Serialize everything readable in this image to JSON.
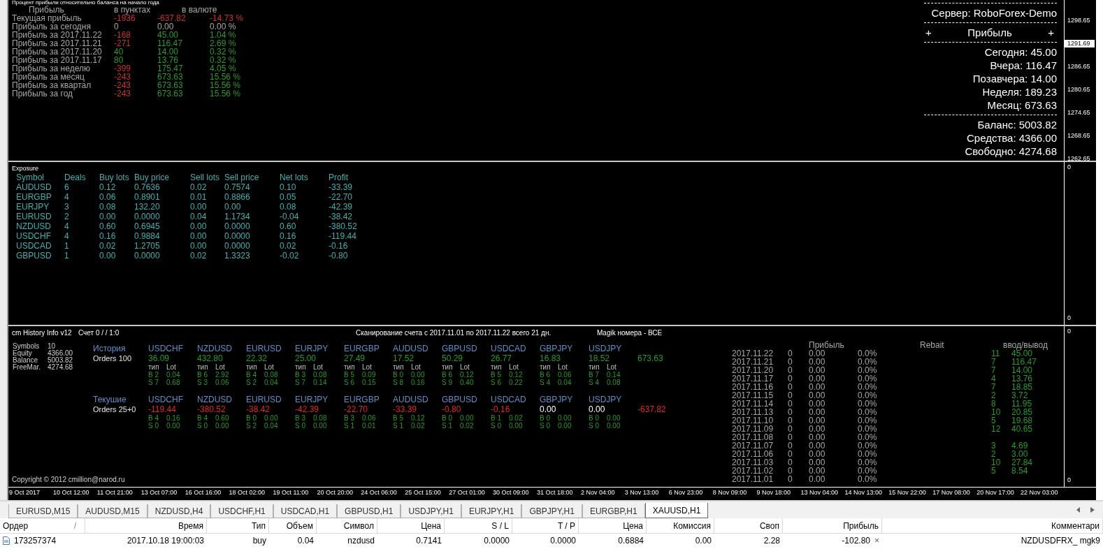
{
  "profit_panel": {
    "caption": "Процент прибыли относительно баланса на начало года",
    "headers": [
      "Прибыль",
      "в пунктах",
      "в валюте"
    ],
    "rows": [
      {
        "label": "Текущая прибыль",
        "cells": [
          {
            "text": "-1936",
            "color": "#c83232"
          },
          {
            "text": "-637.82",
            "color": "#c83232"
          },
          {
            "text": "-14.73 %",
            "color": "#c83232"
          }
        ]
      },
      {
        "label": "Прибыль за сегодня",
        "cells": [
          {
            "text": "0",
            "color": "#a8a8a8"
          },
          {
            "text": "0.00",
            "color": "#a8a8a8"
          },
          {
            "text": "0.00 %",
            "color": "#a8a8a8"
          }
        ]
      },
      {
        "label": "Прибыль за 2017.11.22",
        "cells": [
          {
            "text": "-168",
            "color": "#c83232"
          },
          {
            "text": "45.00",
            "color": "#2c9a2c"
          },
          {
            "text": "1.04 %",
            "color": "#2c9a2c"
          }
        ]
      },
      {
        "label": "Прибыль за 2017.11.21",
        "cells": [
          {
            "text": "-271",
            "color": "#c83232"
          },
          {
            "text": "116.47",
            "color": "#2c9a2c"
          },
          {
            "text": "2.69 %",
            "color": "#2c9a2c"
          }
        ]
      },
      {
        "label": "Прибыль за 2017.11.20",
        "cells": [
          {
            "text": "40",
            "color": "#2c9a2c"
          },
          {
            "text": "14.00",
            "color": "#2c9a2c"
          },
          {
            "text": "0.32 %",
            "color": "#2c9a2c"
          }
        ]
      },
      {
        "label": "Прибыль за 2017.11.17",
        "cells": [
          {
            "text": "80",
            "color": "#2c9a2c"
          },
          {
            "text": "13.76",
            "color": "#2c9a2c"
          },
          {
            "text": "0.32 %",
            "color": "#2c9a2c"
          }
        ]
      },
      {
        "label": "Прибыль за неделю",
        "cells": [
          {
            "text": "-399",
            "color": "#c83232"
          },
          {
            "text": "175.47",
            "color": "#2c9a2c"
          },
          {
            "text": "4.05 %",
            "color": "#2c9a2c"
          }
        ]
      },
      {
        "label": "Прибыль за месяц",
        "cells": [
          {
            "text": "-243",
            "color": "#c83232"
          },
          {
            "text": "673.63",
            "color": "#2c9a2c"
          },
          {
            "text": "15.56 %",
            "color": "#2c9a2c"
          }
        ]
      },
      {
        "label": "Прибыль за квартал",
        "cells": [
          {
            "text": "-243",
            "color": "#c83232"
          },
          {
            "text": "673.63",
            "color": "#2c9a2c"
          },
          {
            "text": "15.56 %",
            "color": "#2c9a2c"
          }
        ]
      },
      {
        "label": "Прибыль за год",
        "cells": [
          {
            "text": "-243",
            "color": "#c83232"
          },
          {
            "text": "673.63",
            "color": "#2c9a2c"
          },
          {
            "text": "15.56 %",
            "color": "#2c9a2c"
          }
        ]
      }
    ]
  },
  "info_panel": {
    "server": "Сервер: RoboForex-Demo",
    "profit_heading": [
      "+",
      "Прибыль",
      "+"
    ],
    "stats": [
      "Сегодня: 45.00",
      "Вчера: 116.47",
      "Позавчера: 14.00",
      "Неделя: 189.23",
      "Месяц: 673.63"
    ],
    "balance": [
      "Баланс: 5003.82",
      "Средства: 4366.00",
      "Свободно: 4274.68"
    ]
  },
  "price_scale": [
    {
      "text": "1298.65",
      "kind": "tick"
    },
    {
      "text": "1291.69",
      "kind": "current"
    },
    {
      "text": "1286.65",
      "kind": "tick"
    },
    {
      "text": "1280.65",
      "kind": "tick"
    },
    {
      "text": "1274.65",
      "kind": "tick"
    },
    {
      "text": "1268.65",
      "kind": "tick"
    },
    {
      "text": "1262.65",
      "kind": "tick"
    }
  ],
  "exposure": {
    "title": "Exposure",
    "columns": [
      "Symbol",
      "Deals",
      "Buy lots",
      "Buy price",
      "Sell lots",
      "Sell price",
      "Net lots",
      "Profit"
    ],
    "rows": [
      [
        "AUDUSD",
        "6",
        "0.12",
        "0.7636",
        "0.02",
        "0.7574",
        "0.10",
        "-33.39"
      ],
      [
        "EURGBP",
        "4",
        "0.06",
        "0.8901",
        "0.01",
        "0.8866",
        "0.05",
        "-22.70"
      ],
      [
        "EURJPY",
        "3",
        "0.08",
        "132.20",
        "0.00",
        "0.00",
        "0.08",
        "-42.39"
      ],
      [
        "EURUSD",
        "2",
        "0.00",
        "0.0000",
        "0.04",
        "1.1734",
        "-0.04",
        "-38.42"
      ],
      [
        "NZDUSD",
        "4",
        "0.60",
        "0.6945",
        "0.00",
        "0.0000",
        "0.60",
        "-380.52"
      ],
      [
        "USDCHF",
        "4",
        "0.16",
        "0.9884",
        "0.00",
        "0.0000",
        "0.16",
        "-119.44"
      ],
      [
        "USDCAD",
        "1",
        "0.02",
        "1.2705",
        "0.00",
        "0.0000",
        "0.02",
        "-0.16"
      ],
      [
        "GBPUSD",
        "1",
        "0.00",
        "0.0000",
        "0.02",
        "1.3323",
        "-0.02",
        "-0.80"
      ]
    ],
    "scale": [
      "0",
      "0"
    ]
  },
  "history_panel": {
    "title": "cm History Info v12",
    "account": "Счет 0 / / 1:0",
    "scan": "Сканирование счета с 2017.11.01 по 2017.11.22 всего 21 дн.",
    "magic": "Magik номера - ВСЕ",
    "account_info": [
      {
        "label": "Symbols",
        "value": "10"
      },
      {
        "label": "Equity",
        "value": "4366.00"
      },
      {
        "label": "Balance",
        "value": "5003.82"
      },
      {
        "label": "FreeMar.",
        "value": "4274.68"
      }
    ],
    "groups": [
      {
        "label": "История",
        "orders": "Orders 100",
        "total": {
          "text": "673.63",
          "color": "#2c9a2c"
        },
        "symbols": [
          {
            "name": "USDCHF",
            "value": "36.09",
            "color": "#2c9a2c",
            "type_label": "тип",
            "lot_label": "Lot",
            "buy": [
              "B 2",
              "0.04"
            ],
            "sell": [
              "S 7",
              "0.68"
            ]
          },
          {
            "name": "NZDUSD",
            "value": "432.80",
            "color": "#2c9a2c",
            "type_label": "тип",
            "lot_label": "Lot",
            "buy": [
              "B 6",
              "2.92"
            ],
            "sell": [
              "S 3",
              "0.06"
            ]
          },
          {
            "name": "EURUSD",
            "value": "22.32",
            "color": "#2c9a2c",
            "type_label": "тип",
            "lot_label": "Lot",
            "buy": [
              "B 4",
              "0.08"
            ],
            "sell": [
              "S 2",
              "0.04"
            ]
          },
          {
            "name": "EURJPY",
            "value": "25.00",
            "color": "#2c9a2c",
            "type_label": "тип",
            "lot_label": "Lot",
            "buy": [
              "B 3",
              "0.08"
            ],
            "sell": [
              "S 7",
              "0.14"
            ]
          },
          {
            "name": "EURGBP",
            "value": "27.49",
            "color": "#2c9a2c",
            "type_label": "тип",
            "lot_label": "Lot",
            "buy": [
              "B 5",
              "0.09"
            ],
            "sell": [
              "S 6",
              "0.15"
            ]
          },
          {
            "name": "AUDUSD",
            "value": "17.52",
            "color": "#2c9a2c",
            "type_label": "тип",
            "lot_label": "Lot",
            "buy": [
              "B 0",
              "0.00"
            ],
            "sell": [
              "S 8",
              "0.16"
            ]
          },
          {
            "name": "GBPUSD",
            "value": "50.29",
            "color": "#2c9a2c",
            "type_label": "тип",
            "lot_label": "Lot",
            "buy": [
              "B 6",
              "0.12"
            ],
            "sell": [
              "S 9",
              "0.40"
            ]
          },
          {
            "name": "USDCAD",
            "value": "26.77",
            "color": "#2c9a2c",
            "type_label": "тип",
            "lot_label": "Lot",
            "buy": [
              "B 5",
              "0.12"
            ],
            "sell": [
              "S 6",
              "0.22"
            ]
          },
          {
            "name": "GBPJPY",
            "value": "16.83",
            "color": "#2c9a2c",
            "type_label": "тип",
            "lot_label": "Lot",
            "buy": [
              "B 6",
              "0.06"
            ],
            "sell": [
              "S 4",
              "0.04"
            ]
          },
          {
            "name": "USDJPY",
            "value": "18.52",
            "color": "#2c9a2c",
            "type_label": "тип",
            "lot_label": "Lot",
            "buy": [
              "B 7",
              "0.14"
            ],
            "sell": [
              "S 4",
              "0.08"
            ]
          }
        ]
      },
      {
        "label": "Текушие",
        "orders": "Orders 25+0",
        "total": {
          "text": "-637.82",
          "color": "#e02828"
        },
        "symbols": [
          {
            "name": "USDCHF",
            "value": "-119.44",
            "color": "#e02828",
            "buy": [
              "B 4",
              "0.16"
            ],
            "sell": [
              "S 0",
              "0.00"
            ]
          },
          {
            "name": "NZDUSD",
            "value": "-380.52",
            "color": "#e02828",
            "buy": [
              "B 4",
              "0.60"
            ],
            "sell": [
              "S 0",
              "0.00"
            ]
          },
          {
            "name": "EURUSD",
            "value": "-38.42",
            "color": "#e02828",
            "buy": [
              "B 0",
              "0.00"
            ],
            "sell": [
              "S 2",
              "0.04"
            ]
          },
          {
            "name": "EURJPY",
            "value": "-42.39",
            "color": "#e02828",
            "buy": [
              "B 3",
              "0.08"
            ],
            "sell": [
              "S 0",
              "0.00"
            ]
          },
          {
            "name": "EURGBP",
            "value": "-22.70",
            "color": "#e02828",
            "buy": [
              "B 3",
              "0.06"
            ],
            "sell": [
              "S 1",
              "0.01"
            ]
          },
          {
            "name": "AUDUSD",
            "value": "-33.39",
            "color": "#e02828",
            "buy": [
              "B 5",
              "0.12"
            ],
            "sell": [
              "S 1",
              "0.02"
            ]
          },
          {
            "name": "GBPUSD",
            "value": "-0.80",
            "color": "#e02828",
            "buy": [
              "B 0",
              "0.00"
            ],
            "sell": [
              "S 1",
              "0.02"
            ]
          },
          {
            "name": "USDCAD",
            "value": "-0.16",
            "color": "#e02828",
            "buy": [
              "B 1",
              "0.02"
            ],
            "sell": [
              "S 0",
              "0.00"
            ]
          },
          {
            "name": "GBPJPY",
            "value": "0.00",
            "color": "#ffffff",
            "buy": [
              "B 0",
              "0.00"
            ],
            "sell": [
              "S 0",
              "0.00"
            ]
          },
          {
            "name": "USDJPY",
            "value": "0.00",
            "color": "#ffffff",
            "buy": [
              "B 0",
              "0.00"
            ],
            "sell": [
              "S 0",
              "0.00"
            ]
          }
        ]
      }
    ],
    "daily_headers": [
      "Прибыль",
      "Rebait",
      "ввод/вывод"
    ],
    "daily": [
      [
        "2017.11.22",
        "0",
        "0.00",
        "0.0%",
        "11",
        "45.00"
      ],
      [
        "2017.11.21",
        "0",
        "0.00",
        "0.0%",
        "7",
        "116.47"
      ],
      [
        "2017.11.20",
        "0",
        "0.00",
        "0.0%",
        "7",
        "14.00"
      ],
      [
        "2017.11.17",
        "0",
        "0.00",
        "0.0%",
        "4",
        "13.76"
      ],
      [
        "2017.11.16",
        "0",
        "0.00",
        "0.0%",
        "7",
        "18.85"
      ],
      [
        "2017.11.15",
        "0",
        "0.00",
        "0.0%",
        "2",
        "3.72"
      ],
      [
        "2017.11.14",
        "0",
        "0.00",
        "0.0%",
        "8",
        "11.95"
      ],
      [
        "2017.11.13",
        "0",
        "0.00",
        "0.0%",
        "10",
        "20.85"
      ],
      [
        "2017.11.10",
        "0",
        "0.00",
        "0.0%",
        "5",
        "19.68"
      ],
      [
        "2017.11.09",
        "0",
        "0.00",
        "0.0%",
        "12",
        "40.65"
      ],
      [
        "2017.11.08",
        "0",
        "0.00",
        "0.0%"
      ],
      [
        "2017.11.07",
        "0",
        "0.00",
        "0.0%",
        "3",
        "4.69"
      ],
      [
        "2017.11.06",
        "0",
        "0.00",
        "0.0%",
        "2",
        "3.00"
      ],
      [
        "2017.11.03",
        "0",
        "0.00",
        "0.0%",
        "10",
        "27.84"
      ],
      [
        "2017.11.02",
        "0",
        "0.00",
        "0.0%",
        "5",
        "8.54"
      ],
      [
        "2017.11.01",
        "0",
        "0.00",
        "0.0%"
      ]
    ],
    "copyright": "Copyright © 2012 cmillion@narod.ru",
    "scale": [
      "0",
      "0"
    ]
  },
  "time_axis": [
    "9 Oct 2017",
    "10 Oct 12:00",
    "11 Oct 21:00",
    "13 Oct 07:00",
    "16 Oct 16:00",
    "18 Oct 02:00",
    "19 Oct 11:00",
    "20 Oct 20:00",
    "24 Oct 06:00",
    "25 Oct 15:00",
    "27 Oct 01:00",
    "30 Oct 09:00",
    "31 Oct 18:00",
    "2 Nov 04:00",
    "3 Nov 13:00",
    "6 Nov 23:00",
    "8 Nov 09:00",
    "9 Nov 18:00",
    "13 Nov 04:00",
    "14 Nov 13:00",
    "15 Nov 22:00",
    "17 Nov 08:00",
    "20 Nov 17:00",
    "22 Nov 03:00"
  ],
  "tabs": [
    {
      "label": "EURUSD,M15",
      "selected": false
    },
    {
      "label": "AUDUSD,M15",
      "selected": false
    },
    {
      "label": "NZDUSD,H4",
      "selected": false
    },
    {
      "label": "USDCHF,H1",
      "selected": false
    },
    {
      "label": "USDCAD,H1",
      "selected": false
    },
    {
      "label": "GBPUSD,H1",
      "selected": false
    },
    {
      "label": "USDJPY,H1",
      "selected": false
    },
    {
      "label": "EURJPY,H1",
      "selected": false
    },
    {
      "label": "GBPJPY,H1",
      "selected": false
    },
    {
      "label": "EURGBP,H1",
      "selected": false
    },
    {
      "label": "XAUUSD,H1",
      "selected": true
    }
  ],
  "orders": {
    "columns": [
      "Ордер",
      "Время",
      "Тип",
      "Объем",
      "Символ",
      "Цена",
      "S / L",
      "T / P",
      "Цена",
      "Комиссия",
      "Своп",
      "Прибыль",
      "Комментари"
    ],
    "sort_mark": "/",
    "rows": [
      {
        "cells": [
          "173257374",
          "2017.10.18 19:00:03",
          "buy",
          "0.04",
          "nzdusd",
          "0.7141",
          "0.0000",
          "0.0000",
          "0.6884",
          "0.00",
          "2.28",
          "-102.80",
          "NZDUSDFRX_ mgk9"
        ],
        "close": "×"
      }
    ]
  }
}
